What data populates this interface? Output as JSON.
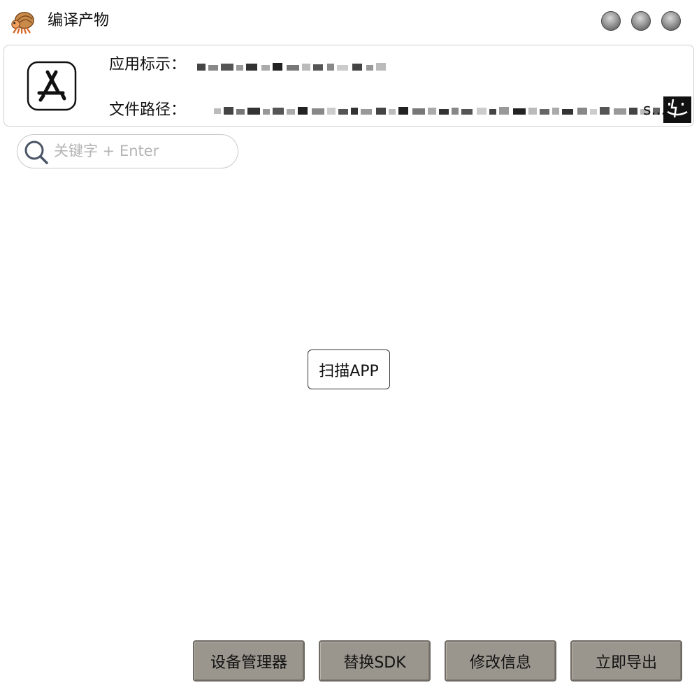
{
  "window": {
    "title": "编译产物",
    "logo_icon": "hermit-crab-logo-icon",
    "controls": [
      "window-control-icon",
      "window-control-icon",
      "window-control-icon"
    ]
  },
  "app_info": {
    "icon": "app-store-icon",
    "bundle_id_label": "应用标示：",
    "file_path_label": "文件路径：",
    "file_path_ellipsis": "s...",
    "finder_icon": "finder-icon"
  },
  "search": {
    "icon": "search-icon",
    "placeholder": "关键字 + Enter",
    "value": ""
  },
  "scan_button_label": "扫描APP",
  "actions": {
    "device_manager": "设备管理器",
    "replace_sdk": "替换SDK",
    "modify_info": "修改信息",
    "export_now": "立即导出"
  },
  "colors": {
    "action_button_bg": "#9a958d",
    "action_button_border": "#6f6b64",
    "card_border": "#cfcfcf"
  }
}
